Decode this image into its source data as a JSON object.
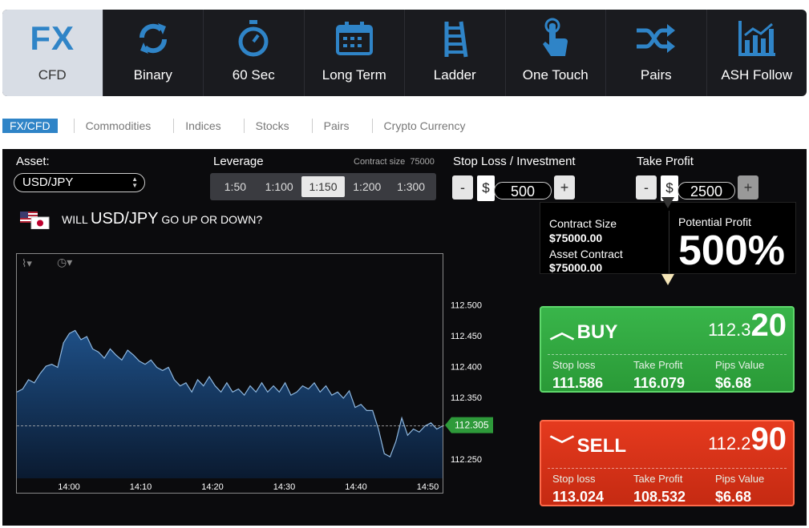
{
  "tabs": [
    {
      "label": "CFD",
      "icon": "fx-logo",
      "active": true
    },
    {
      "label": "Binary",
      "icon": "sync-icon"
    },
    {
      "label": "60 Sec",
      "icon": "stopwatch-icon"
    },
    {
      "label": "Long Term",
      "icon": "calendar-icon"
    },
    {
      "label": "Ladder",
      "icon": "ladder-icon"
    },
    {
      "label": "One Touch",
      "icon": "touch-icon"
    },
    {
      "label": "Pairs",
      "icon": "shuffle-icon"
    },
    {
      "label": "ASH Follow",
      "icon": "bar-chart-icon"
    }
  ],
  "fx_logo_text": "FX",
  "subnav": [
    "FX/CFD",
    "Commodities",
    "Indices",
    "Stocks",
    "Pairs",
    "Crypto Currency"
  ],
  "asset": {
    "label": "Asset:",
    "value": "USD/JPY"
  },
  "leverage": {
    "label": "Leverage",
    "contract_label": "Contract size",
    "contract_value": "75000",
    "options": [
      "1:50",
      "1:100",
      "1:150",
      "1:200",
      "1:300"
    ],
    "selected": "1:150"
  },
  "stop_loss": {
    "label": "Stop Loss / Investment",
    "minus": "-",
    "plus": "+",
    "currency": "$",
    "value": "500"
  },
  "take_profit": {
    "label": "Take Profit",
    "minus": "-",
    "plus": "+",
    "currency": "$",
    "value": "2500"
  },
  "question": {
    "prefix": "WILL",
    "asset": "USD/JPY",
    "suffix": "GO UP OR DOWN?"
  },
  "info": {
    "contract_size_label": "Contract Size",
    "contract_size_value": "$75000.00",
    "asset_contract_label": "Asset Contract",
    "asset_contract_value": "$75000.00",
    "potential_profit_label": "Potential Profit",
    "potential_profit_value": "500%"
  },
  "buy": {
    "label": "BUY",
    "price_main": "112.3",
    "price_pips": "20",
    "stop_loss_label": "Stop loss",
    "stop_loss": "111.586",
    "take_profit_label": "Take Profit",
    "take_profit": "116.079",
    "pips_label": "Pips Value",
    "pips": "$6.68"
  },
  "sell": {
    "label": "SELL",
    "price_main": "112.2",
    "price_pips": "90",
    "stop_loss_label": "Stop loss",
    "stop_loss": "113.024",
    "take_profit_label": "Take Profit",
    "take_profit": "108.532",
    "pips_label": "Pips Value",
    "pips": "$6.68"
  },
  "chart_data": {
    "type": "area",
    "x_ticks": [
      "14:00",
      "14:10",
      "14:20",
      "14:30",
      "14:40",
      "14:50"
    ],
    "y_ticks": [
      "112.500",
      "112.450",
      "112.400",
      "112.350",
      "112.300",
      "112.250"
    ],
    "ylim": [
      112.22,
      112.545
    ],
    "current_label": "112.305",
    "current_value": 112.305,
    "values": [
      112.36,
      112.365,
      112.38,
      112.375,
      112.39,
      112.402,
      112.405,
      112.4,
      112.44,
      112.455,
      112.46,
      112.445,
      112.45,
      112.43,
      112.425,
      112.415,
      112.43,
      112.42,
      112.412,
      112.428,
      112.42,
      112.41,
      112.405,
      112.412,
      112.4,
      112.395,
      112.4,
      112.38,
      112.37,
      112.375,
      112.36,
      112.38,
      112.37,
      112.385,
      112.37,
      112.36,
      112.375,
      112.36,
      112.365,
      112.355,
      112.37,
      112.36,
      112.375,
      112.36,
      112.37,
      112.36,
      112.375,
      112.355,
      112.36,
      112.37,
      112.365,
      112.375,
      112.36,
      112.37,
      112.355,
      112.36,
      112.35,
      112.362,
      112.335,
      112.34,
      112.33,
      112.33,
      112.3,
      112.26,
      112.255,
      112.28,
      112.318,
      112.29,
      112.3,
      112.295,
      112.305,
      112.31,
      112.3,
      112.305
    ]
  }
}
